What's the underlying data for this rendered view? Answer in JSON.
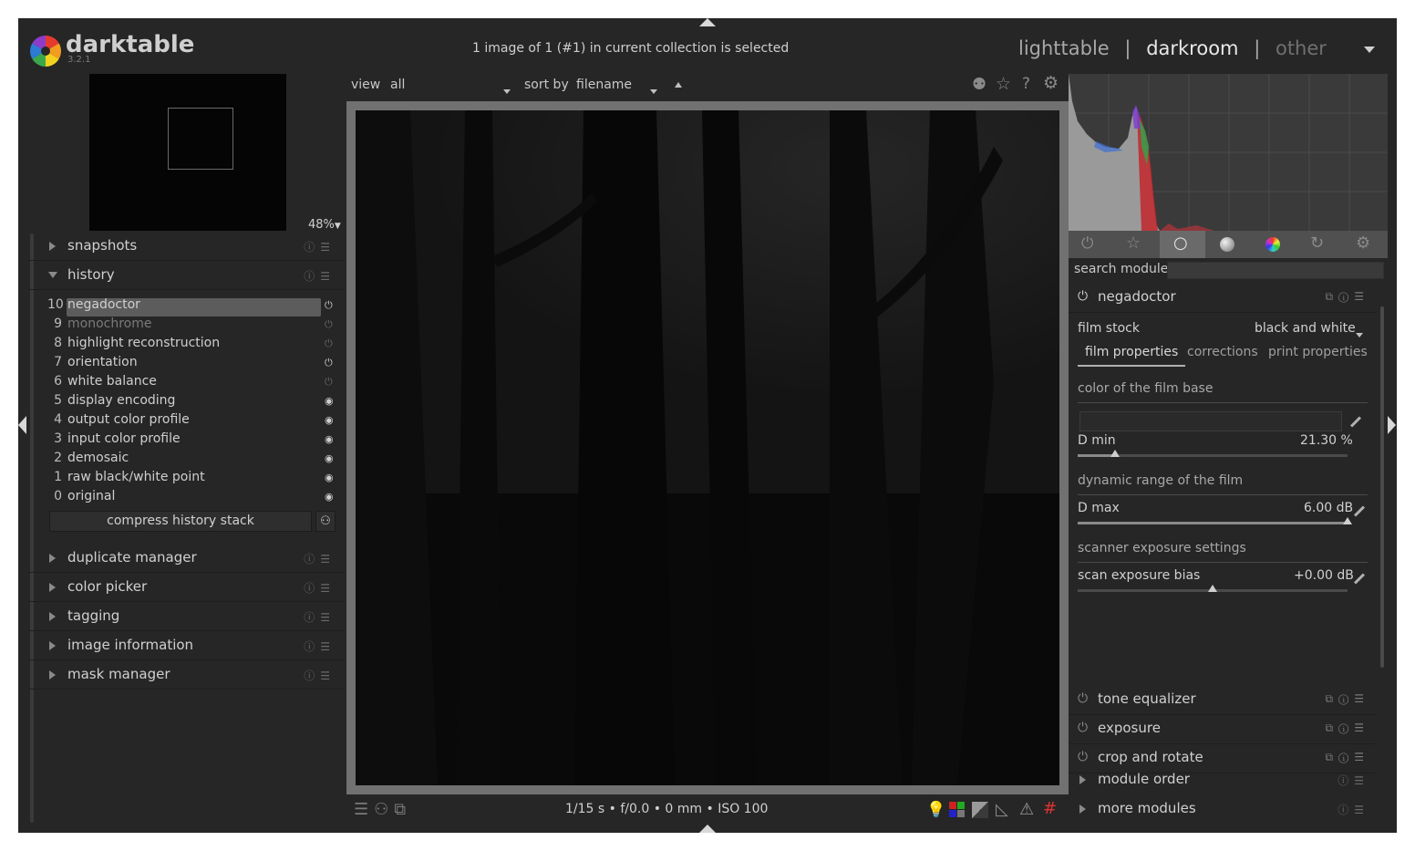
{
  "app": {
    "name": "darktable",
    "version": "3.2.1"
  },
  "header": {
    "status": "1 image of 1 (#1) in current collection is selected",
    "views": [
      "lighttable",
      "|",
      "darkroom",
      "|",
      "other"
    ]
  },
  "navigation": {
    "zoom": "48%"
  },
  "left_modules": [
    {
      "label": "snapshots"
    },
    {
      "label": "history"
    }
  ],
  "history": {
    "items": [
      {
        "num": "10",
        "label": "negadoctor"
      },
      {
        "num": "9",
        "label": "monochrome"
      },
      {
        "num": "8",
        "label": "highlight reconstruction"
      },
      {
        "num": "7",
        "label": "orientation"
      },
      {
        "num": "6",
        "label": "white balance"
      },
      {
        "num": "5",
        "label": "display encoding"
      },
      {
        "num": "4",
        "label": "output color profile"
      },
      {
        "num": "3",
        "label": "input color profile"
      },
      {
        "num": "2",
        "label": "demosaic"
      },
      {
        "num": "1",
        "label": "raw black/white point"
      },
      {
        "num": "0",
        "label": "original"
      }
    ],
    "compress_label": "compress history stack"
  },
  "left_modules_bottom": [
    {
      "label": "duplicate manager"
    },
    {
      "label": "color picker"
    },
    {
      "label": "tagging"
    },
    {
      "label": "image information"
    },
    {
      "label": "mask manager"
    }
  ],
  "toolbar": {
    "view_label": "view",
    "view_value": "all",
    "sort_label": "sort by",
    "sort_value": "filename"
  },
  "footer": {
    "exif": "1/15 s • f/0.0 • 0 mm • ISO 100"
  },
  "right": {
    "search_label": "search module",
    "active_module": {
      "name": "negadoctor",
      "film_stock_label": "film stock",
      "film_stock_value": "black and white",
      "tabs": [
        "film properties",
        "corrections",
        "print properties"
      ],
      "sections": {
        "film_base": "color of the film base",
        "dynamic_range": "dynamic range of the film",
        "scanner": "scanner exposure settings"
      },
      "dmin_label": "D min",
      "dmin_value": "21.30 %",
      "dmin_fraction": 0.14,
      "dmax_label": "D max",
      "dmax_value": "6.00 dB",
      "dmax_fraction": 1.0,
      "bias_label": "scan exposure bias",
      "bias_value": "+0.00 dB",
      "bias_fraction": 0.5
    },
    "modules": [
      {
        "label": "tone equalizer"
      },
      {
        "label": "exposure"
      },
      {
        "label": "crop and rotate"
      }
    ],
    "module_order_label": "module order",
    "more_modules_label": "more modules"
  },
  "colors": {
    "background": "#262626",
    "selected_row": "#5c5c5c",
    "image": "#0a0a0a"
  }
}
